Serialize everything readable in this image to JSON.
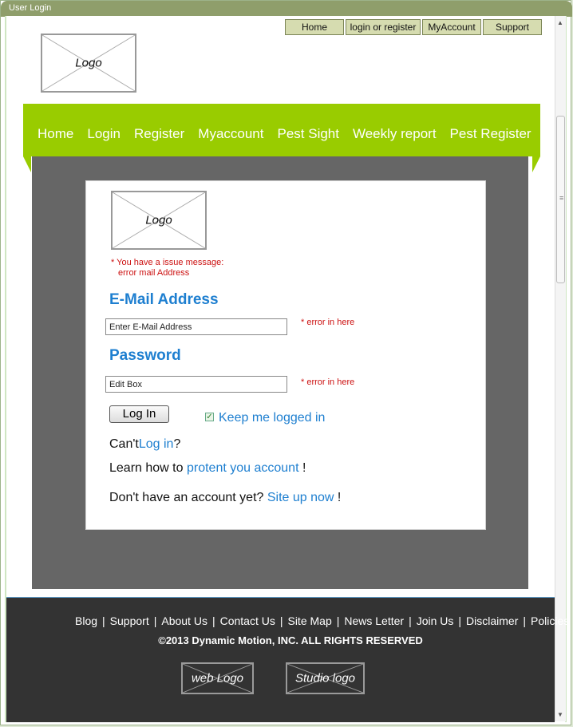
{
  "window": {
    "title": "User Login"
  },
  "top_nav": [
    {
      "label": "Home"
    },
    {
      "label": "login or register"
    },
    {
      "label": "MyAccount"
    },
    {
      "label": "Support"
    }
  ],
  "header_logo": {
    "label": "Logo"
  },
  "main_nav": [
    {
      "label": "Home"
    },
    {
      "label": "Login"
    },
    {
      "label": "Register"
    },
    {
      "label": "Myaccount"
    },
    {
      "label": "Pest Sight"
    },
    {
      "label": "Weekly report"
    },
    {
      "label": "Pest Register"
    }
  ],
  "login": {
    "logo_label": "Logo",
    "issue_line1": "* You have a issue message:",
    "issue_line2": "error mail Address",
    "email_label": "E-Mail Address",
    "email_placeholder": "Enter E-Mail Address",
    "email_error": "* error in here",
    "password_label": "Password",
    "password_placeholder": "Edit Box",
    "password_error": "* error in here",
    "login_button": "Log In",
    "keep_logged_in": "Keep me logged in",
    "keep_logged_in_checked": true,
    "cant_prefix": "Can't",
    "cant_link": "Log in",
    "cant_suffix": "?",
    "learn_prefix": "Learn how to",
    "learn_link": "protent you account",
    "learn_suffix": "!",
    "noacct_prefix": "Don't have an account yet?",
    "noacct_link": "Site up now",
    "noacct_suffix": "!"
  },
  "footer": {
    "links": [
      "Blog",
      "Support",
      "About Us",
      "Contact Us",
      "Site Map",
      "News Letter",
      "Join Us",
      "Disclaimer",
      "Policies"
    ],
    "separator": "|",
    "copyright": "©2013 Dynamic Motion, INC. ALL RIGHTS RESERVED",
    "logos": [
      {
        "label": "web Logo"
      },
      {
        "label": "Studio logo"
      }
    ]
  },
  "colors": {
    "accent_green": "#99cc00",
    "panel_gray": "#666666",
    "footer_bg": "#333333",
    "link_blue": "#1e7fd0",
    "error_red": "#cc1111",
    "titlebar": "#8f9e6b"
  }
}
